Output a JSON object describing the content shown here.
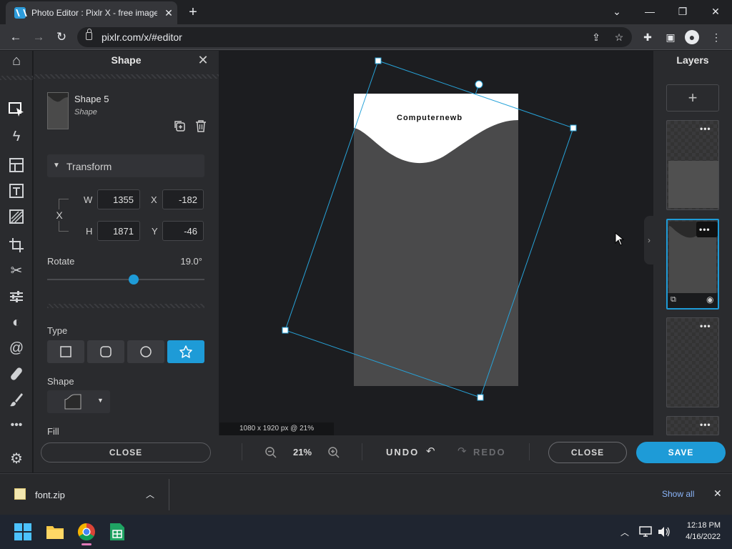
{
  "browser": {
    "tab_title": "Photo Editor : Pixlr X - free image",
    "url": "pixlr.com/x/#editor"
  },
  "panel": {
    "title": "Shape",
    "layer_name": "Shape 5",
    "layer_type": "Shape",
    "transform_label": "Transform",
    "w_label": "W",
    "w_value": "1355",
    "x_label": "X",
    "x_value": "-182",
    "h_label": "H",
    "h_value": "1871",
    "y_label": "Y",
    "y_value": "-46",
    "link_label": "X",
    "rotate_label": "Rotate",
    "rotate_value": "19.0°",
    "rotate_fraction": 0.55,
    "type_label": "Type",
    "shape_label": "Shape",
    "fill_label": "Fill",
    "close_label": "CLOSE"
  },
  "canvas": {
    "doc_text": "Computernewb",
    "info": "1080 x 1920 px @ 21%"
  },
  "bottombar": {
    "zoom": "21%",
    "undo": "UNDO",
    "redo": "REDO",
    "close": "CLOSE",
    "save": "SAVE"
  },
  "layers": {
    "title": "Layers"
  },
  "downloads": {
    "file": "font.zip",
    "show_all": "Show all"
  },
  "taskbar": {
    "time": "12:18 PM",
    "date": "4/16/2022"
  },
  "colors": {
    "accent": "#1e9bd7",
    "panel": "#2a2b2e",
    "canvas_bg": "#1c1d20"
  }
}
